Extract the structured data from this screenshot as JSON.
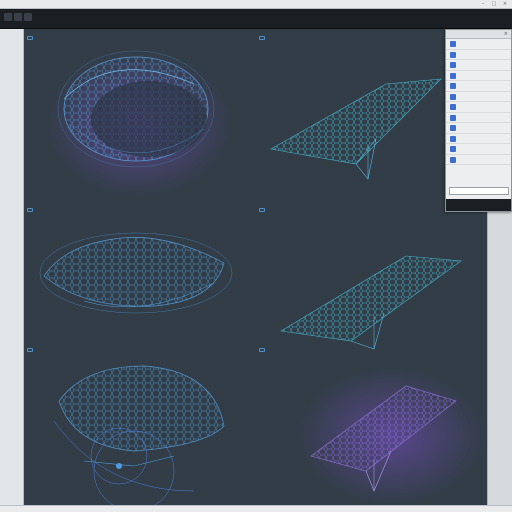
{
  "window": {
    "title": ""
  },
  "toolbar": {
    "menu_label": ""
  },
  "panels": [
    {
      "title": "",
      "subtitle": ""
    },
    {
      "title": "",
      "subtitle": ""
    },
    {
      "title": "",
      "subtitle": ""
    },
    {
      "title": "",
      "subtitle": ""
    },
    {
      "title": "",
      "subtitle": ""
    },
    {
      "title": "",
      "subtitle": ""
    }
  ],
  "properties": {
    "title": "",
    "rows": [
      {
        "label": "",
        "value": ""
      },
      {
        "label": "",
        "value": ""
      },
      {
        "label": "",
        "value": ""
      },
      {
        "label": "",
        "value": ""
      },
      {
        "label": "",
        "value": ""
      },
      {
        "label": "",
        "value": ""
      },
      {
        "label": "",
        "value": ""
      },
      {
        "label": "",
        "value": ""
      },
      {
        "label": "",
        "value": ""
      },
      {
        "label": "",
        "value": ""
      },
      {
        "label": "",
        "value": ""
      },
      {
        "label": "",
        "value": ""
      }
    ]
  },
  "status": {
    "left": "",
    "right": ""
  },
  "colors": {
    "canvas": "#323d47",
    "mesh_blue": "#4fa3e6",
    "mesh_cyan": "#47c7e0",
    "glow_purple": "#7b4fc9",
    "accent": "#3e6fcf"
  },
  "icons": [
    "close-icon",
    "minimize-icon",
    "maximize-icon",
    "panel-icon"
  ]
}
